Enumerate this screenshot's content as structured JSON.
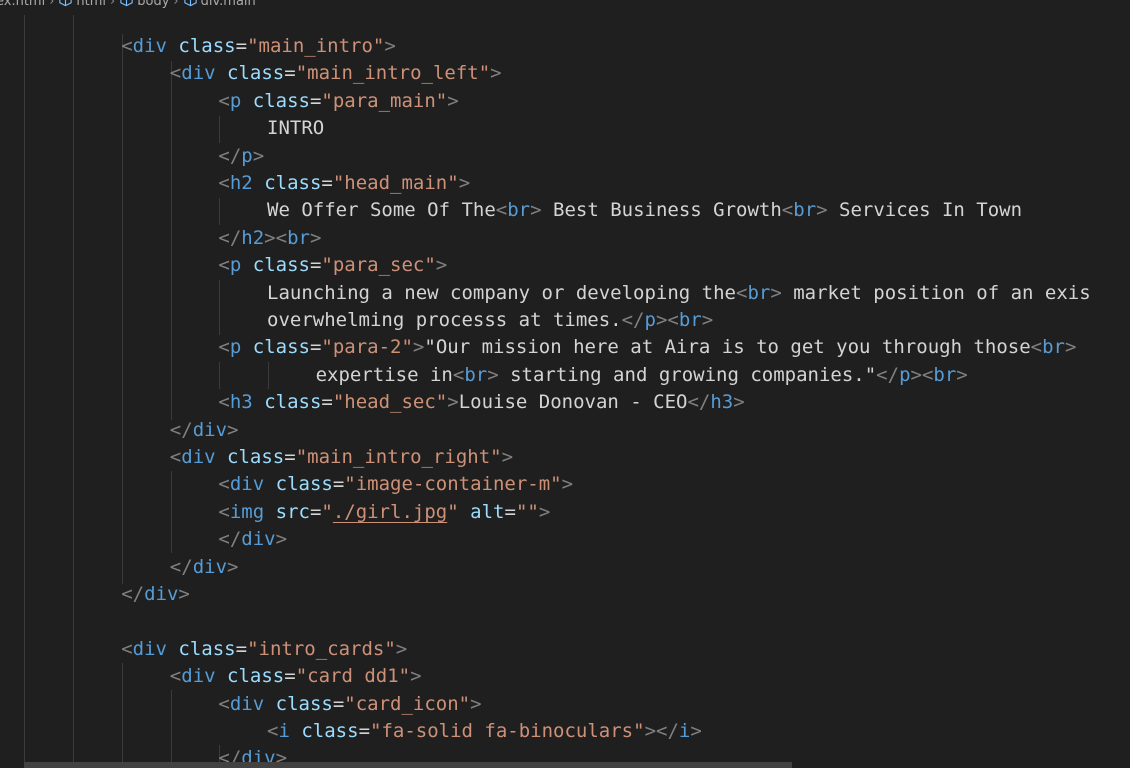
{
  "breadcrumb": {
    "items": [
      {
        "label": "ex.html",
        "icon": ""
      },
      {
        "label": "html",
        "icon": "cube-icon"
      },
      {
        "label": "body",
        "icon": "cube-icon"
      },
      {
        "label": "div.main",
        "icon": "cube-icon"
      }
    ]
  },
  "colors": {
    "background": "#1f1f1f",
    "tag": "#569cd6",
    "attribute": "#9cdcfe",
    "string": "#ce9178",
    "punctuation": "#808080",
    "text": "#d4d4d4"
  },
  "code": {
    "lines": [
      {
        "indent": 2,
        "tokens": [
          [
            "p",
            "<"
          ],
          [
            "t",
            "div"
          ],
          [
            "x",
            " "
          ],
          [
            "a",
            "class"
          ],
          [
            "x",
            "="
          ],
          [
            "s",
            "\"main_intro\""
          ],
          [
            "p",
            ">"
          ]
        ]
      },
      {
        "indent": 3,
        "tokens": [
          [
            "p",
            "<"
          ],
          [
            "t",
            "div"
          ],
          [
            "x",
            " "
          ],
          [
            "a",
            "class"
          ],
          [
            "x",
            "="
          ],
          [
            "s",
            "\"main_intro_left\""
          ],
          [
            "p",
            ">"
          ]
        ]
      },
      {
        "indent": 4,
        "tokens": [
          [
            "p",
            "<"
          ],
          [
            "t",
            "p"
          ],
          [
            "x",
            " "
          ],
          [
            "a",
            "class"
          ],
          [
            "x",
            "="
          ],
          [
            "s",
            "\"para_main\""
          ],
          [
            "p",
            ">"
          ]
        ]
      },
      {
        "indent": 5,
        "tokens": [
          [
            "x",
            "INTRO"
          ]
        ]
      },
      {
        "indent": 4,
        "tokens": [
          [
            "p",
            "</"
          ],
          [
            "t",
            "p"
          ],
          [
            "p",
            ">"
          ]
        ]
      },
      {
        "indent": 4,
        "tokens": [
          [
            "p",
            "<"
          ],
          [
            "t",
            "h2"
          ],
          [
            "x",
            " "
          ],
          [
            "a",
            "class"
          ],
          [
            "x",
            "="
          ],
          [
            "s",
            "\"head_main\""
          ],
          [
            "p",
            ">"
          ]
        ]
      },
      {
        "indent": 5,
        "tokens": [
          [
            "x",
            "We Offer Some Of The"
          ],
          [
            "p",
            "<"
          ],
          [
            "t",
            "br"
          ],
          [
            "p",
            ">"
          ],
          [
            "x",
            " Best Business Growth"
          ],
          [
            "p",
            "<"
          ],
          [
            "t",
            "br"
          ],
          [
            "p",
            ">"
          ],
          [
            "x",
            " Services In Town"
          ]
        ]
      },
      {
        "indent": 4,
        "tokens": [
          [
            "p",
            "</"
          ],
          [
            "t",
            "h2"
          ],
          [
            "p",
            "><"
          ],
          [
            "t",
            "br"
          ],
          [
            "p",
            ">"
          ]
        ]
      },
      {
        "indent": 4,
        "tokens": [
          [
            "p",
            "<"
          ],
          [
            "t",
            "p"
          ],
          [
            "x",
            " "
          ],
          [
            "a",
            "class"
          ],
          [
            "x",
            "="
          ],
          [
            "s",
            "\"para_sec\""
          ],
          [
            "p",
            ">"
          ]
        ]
      },
      {
        "indent": 5,
        "tokens": [
          [
            "x",
            "Launching a new company or developing the"
          ],
          [
            "p",
            "<"
          ],
          [
            "t",
            "br"
          ],
          [
            "p",
            ">"
          ],
          [
            "x",
            " market position of an exis"
          ]
        ]
      },
      {
        "indent": 5,
        "tokens": [
          [
            "x",
            "overwhelming processs at times."
          ],
          [
            "p",
            "</"
          ],
          [
            "t",
            "p"
          ],
          [
            "p",
            "><"
          ],
          [
            "t",
            "br"
          ],
          [
            "p",
            ">"
          ]
        ]
      },
      {
        "indent": 4,
        "tokens": [
          [
            "p",
            "<"
          ],
          [
            "t",
            "p"
          ],
          [
            "x",
            " "
          ],
          [
            "a",
            "class"
          ],
          [
            "x",
            "="
          ],
          [
            "s",
            "\"para-2\""
          ],
          [
            "p",
            ">"
          ],
          [
            "x",
            "\"Our mission here at Aira is to get you through those"
          ],
          [
            "p",
            "<"
          ],
          [
            "t",
            "br"
          ],
          [
            "p",
            ">"
          ]
        ]
      },
      {
        "indent": 6,
        "tokens": [
          [
            "x",
            "expertise in"
          ],
          [
            "p",
            "<"
          ],
          [
            "t",
            "br"
          ],
          [
            "p",
            ">"
          ],
          [
            "x",
            " starting and growing companies.\""
          ],
          [
            "p",
            "</"
          ],
          [
            "t",
            "p"
          ],
          [
            "p",
            "><"
          ],
          [
            "t",
            "br"
          ],
          [
            "p",
            ">"
          ]
        ]
      },
      {
        "indent": 4,
        "tokens": [
          [
            "p",
            "<"
          ],
          [
            "t",
            "h3"
          ],
          [
            "x",
            " "
          ],
          [
            "a",
            "class"
          ],
          [
            "x",
            "="
          ],
          [
            "s",
            "\"head_sec\""
          ],
          [
            "p",
            ">"
          ],
          [
            "x",
            "Louise Donovan - CEO"
          ],
          [
            "p",
            "</"
          ],
          [
            "t",
            "h3"
          ],
          [
            "p",
            ">"
          ]
        ]
      },
      {
        "indent": 3,
        "tokens": [
          [
            "p",
            "</"
          ],
          [
            "t",
            "div"
          ],
          [
            "p",
            ">"
          ]
        ]
      },
      {
        "indent": 3,
        "tokens": [
          [
            "p",
            "<"
          ],
          [
            "t",
            "div"
          ],
          [
            "x",
            " "
          ],
          [
            "a",
            "class"
          ],
          [
            "x",
            "="
          ],
          [
            "s",
            "\"main_intro_right\""
          ],
          [
            "p",
            ">"
          ]
        ]
      },
      {
        "indent": 4,
        "tokens": [
          [
            "p",
            "<"
          ],
          [
            "t",
            "div"
          ],
          [
            "x",
            " "
          ],
          [
            "a",
            "class"
          ],
          [
            "x",
            "="
          ],
          [
            "s",
            "\"image-container-m\""
          ],
          [
            "p",
            ">"
          ]
        ]
      },
      {
        "indent": 4,
        "tokens": [
          [
            "p",
            "<"
          ],
          [
            "t",
            "img"
          ],
          [
            "x",
            " "
          ],
          [
            "a",
            "src"
          ],
          [
            "x",
            "="
          ],
          [
            "s",
            "\""
          ],
          [
            "s",
            "./girl.jpg"
          ],
          [
            "s",
            "\""
          ],
          [
            "x",
            " "
          ],
          [
            "a",
            "alt"
          ],
          [
            "x",
            "="
          ],
          [
            "s",
            "\"\""
          ],
          [
            "p",
            ">"
          ]
        ]
      },
      {
        "indent": 4,
        "tokens": [
          [
            "p",
            "</"
          ],
          [
            "t",
            "div"
          ],
          [
            "p",
            ">"
          ]
        ]
      },
      {
        "indent": 3,
        "tokens": [
          [
            "p",
            "</"
          ],
          [
            "t",
            "div"
          ],
          [
            "p",
            ">"
          ]
        ]
      },
      {
        "indent": 2,
        "tokens": [
          [
            "p",
            "</"
          ],
          [
            "t",
            "div"
          ],
          [
            "p",
            ">"
          ]
        ]
      },
      {
        "indent": 2,
        "tokens": []
      },
      {
        "indent": 2,
        "tokens": [
          [
            "p",
            "<"
          ],
          [
            "t",
            "div"
          ],
          [
            "x",
            " "
          ],
          [
            "a",
            "class"
          ],
          [
            "x",
            "="
          ],
          [
            "s",
            "\"intro_cards\""
          ],
          [
            "p",
            ">"
          ]
        ]
      },
      {
        "indent": 3,
        "tokens": [
          [
            "p",
            "<"
          ],
          [
            "t",
            "div"
          ],
          [
            "x",
            " "
          ],
          [
            "a",
            "class"
          ],
          [
            "x",
            "="
          ],
          [
            "s",
            "\"card dd1\""
          ],
          [
            "p",
            ">"
          ]
        ]
      },
      {
        "indent": 4,
        "tokens": [
          [
            "p",
            "<"
          ],
          [
            "t",
            "div"
          ],
          [
            "x",
            " "
          ],
          [
            "a",
            "class"
          ],
          [
            "x",
            "="
          ],
          [
            "s",
            "\"card_icon\""
          ],
          [
            "p",
            ">"
          ]
        ]
      },
      {
        "indent": 5,
        "tokens": [
          [
            "p",
            "<"
          ],
          [
            "t",
            "i"
          ],
          [
            "x",
            " "
          ],
          [
            "a",
            "class"
          ],
          [
            "x",
            "="
          ],
          [
            "s",
            "\"fa-solid fa-binoculars\""
          ],
          [
            "p",
            "></"
          ],
          [
            "t",
            "i"
          ],
          [
            "p",
            ">"
          ]
        ]
      },
      {
        "indent": 4,
        "tokens": [
          [
            "p",
            "</"
          ],
          [
            "t",
            "div"
          ],
          [
            "p",
            ">"
          ]
        ]
      }
    ]
  }
}
